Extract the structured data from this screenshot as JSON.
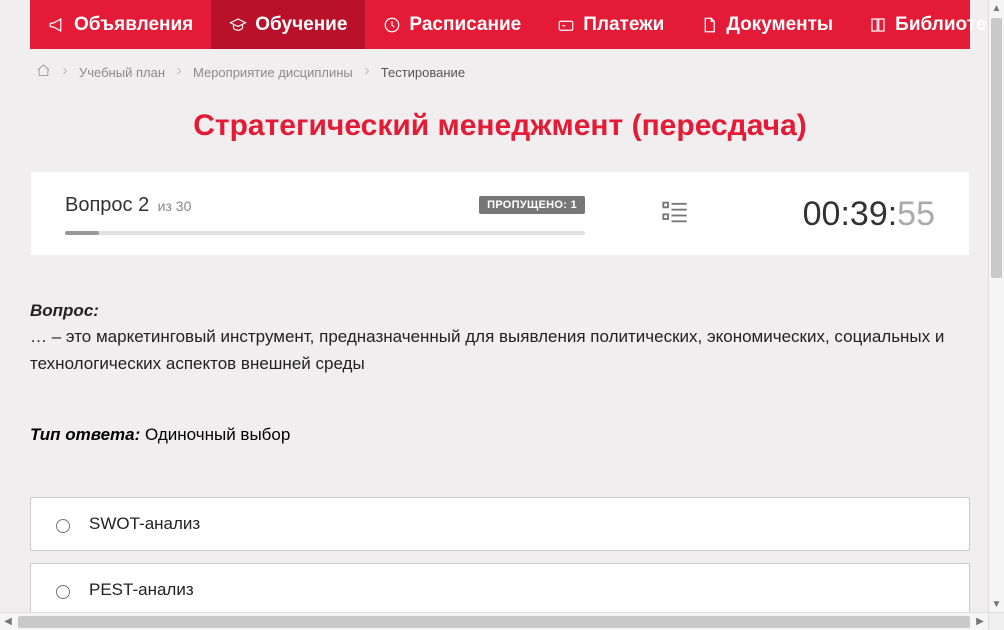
{
  "nav": {
    "items": [
      {
        "label": "Объявления",
        "icon": "megaphone-icon",
        "active": false,
        "dropdown": false
      },
      {
        "label": "Обучение",
        "icon": "graduation-cap-icon",
        "active": true,
        "dropdown": false
      },
      {
        "label": "Расписание",
        "icon": "clock-icon",
        "active": false,
        "dropdown": false
      },
      {
        "label": "Платежи",
        "icon": "payment-icon",
        "active": false,
        "dropdown": false
      },
      {
        "label": "Документы",
        "icon": "document-icon",
        "active": false,
        "dropdown": false
      },
      {
        "label": "Библиотека",
        "icon": "library-icon",
        "active": false,
        "dropdown": true
      }
    ]
  },
  "breadcrumb": {
    "items": [
      "Учебный план",
      "Мероприятие дисциплины"
    ],
    "current": "Тестирование"
  },
  "page": {
    "title": "Стратегический менеджмент (пересдача)"
  },
  "panel": {
    "question_label": "Вопрос 2",
    "of_label": "из 30",
    "skipped_label": "ПРОПУЩЕНО: 1",
    "progress_percent": 6.5,
    "timer_main": "00:39:",
    "timer_secs": "55"
  },
  "question": {
    "label": "Вопрос:",
    "text": "… – это маркетинговый инструмент, предназначенный для выявления политических, экономических, социальных и технологических аспектов внешней среды"
  },
  "answer_type": {
    "label": "Тип ответа:",
    "value": "Одиночный выбор"
  },
  "options": [
    {
      "text": "SWOT-анализ"
    },
    {
      "text": "PEST-анализ"
    }
  ]
}
